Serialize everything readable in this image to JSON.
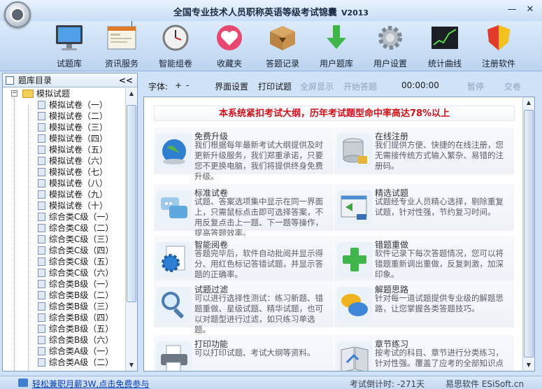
{
  "window": {
    "title": "全国专业技术人员职称英语等级考试锦囊",
    "version": "V2013",
    "minimize": "—",
    "close": "✕"
  },
  "toolbar": {
    "items": [
      {
        "label": "试题库",
        "icon": "monitor-icon"
      },
      {
        "label": "资讯服务",
        "icon": "browser-window-icon"
      },
      {
        "label": "智能组卷",
        "icon": "clock-icon"
      },
      {
        "label": "收藏夹",
        "icon": "heart-icon"
      },
      {
        "label": "答题记录",
        "icon": "box-icon"
      },
      {
        "label": "用户题库",
        "icon": "download-arrow-icon"
      },
      {
        "label": "用户设置",
        "icon": "gear-icon"
      },
      {
        "label": "统计曲线",
        "icon": "chart-icon"
      },
      {
        "label": "注册软件",
        "icon": "shield-icon"
      }
    ]
  },
  "tree": {
    "header": "题库目录",
    "collapse": "<<",
    "root": "模拟试题",
    "items": [
      "模拟试卷（一）",
      "模拟试卷（二）",
      "模拟试卷（三）",
      "模拟试卷（四）",
      "模拟试卷（五）",
      "模拟试卷（六）",
      "模拟试卷（七）",
      "模拟试卷（八）",
      "模拟试卷（九）",
      "模拟试卷（十）",
      "综合类C级（一）",
      "综合类C级（二）",
      "综合类C级（三）",
      "综合类C级（四）",
      "综合类C级（五）",
      "综合类C级（六）",
      "综合类B级（一）",
      "综合类B级（二）",
      "综合类B级（三）",
      "综合类B级（四）",
      "综合类B级（五）",
      "综合类B级（六）",
      "综合类A级（一）",
      "综合类A级（二）"
    ]
  },
  "controls": {
    "font_label": "字体:",
    "font_plus": "+",
    "font_minus": "-",
    "layout": "界面设置",
    "print": "打印试题",
    "fullscreen": "全屏显示",
    "start": "开始答题",
    "time": "00:00:00",
    "pause": "暂停",
    "submit": "交卷"
  },
  "content": {
    "banner": "本系统紧扣考试大纲，历年考试题型命中率高达78%以上",
    "features": [
      {
        "title": "免费升级",
        "desc": "我们根据每年最新考试大纲提供及时更新升级服务，我们郑重承诺，只要您不更换电脑，我们将提供终身免费升级。",
        "icon": "globe-icon"
      },
      {
        "title": "在线注册",
        "desc": "我们提供方便、快捷的在线注册，您无需接传统方式输入繁杂、易错的注册码。",
        "icon": "database-lock-icon"
      },
      {
        "title": "标准试卷",
        "desc": "试题、答案选项集中显示在同一界面上，只需鼠标点击即可选择答案，不用反复点击上一题、下一题等操作，提高答题效率。",
        "icon": "chat-bubbles-icon"
      },
      {
        "title": "精选试题",
        "desc": "试题经专业人员精心选择，剔除重复试题，针对性强，节约复习时间。",
        "icon": "network-window-icon"
      },
      {
        "title": "智能阅卷",
        "desc": "答题完毕后，软件自动批阅并显示得分、用红色标记答错试题，并显示答题的正确率。",
        "icon": "gear-document-icon"
      },
      {
        "title": "错题重做",
        "desc": "软件记录下每次答题情况，您可以将错题重新调出重做，反复刺激，加深印象。",
        "icon": "plus-icon"
      },
      {
        "title": "试题过滤",
        "desc": "可以进行选择性测试：练习新题、错题重做、星级试题、精华试题，也可以对题型进行过滤，如只练习单选题。",
        "icon": "magnifier-icon"
      },
      {
        "title": "解题思路",
        "desc": "针对每一道试题提供专业级的解题思路，让您掌握各类答题技巧。",
        "icon": "speech-bubbles-icon"
      },
      {
        "title": "打印功能",
        "desc": "可以打印试题、考试大纲等资料。",
        "icon": "printer-icon"
      },
      {
        "title": "章节练习",
        "desc": "按考试的科目、章节进行分类练习，针对性强。覆盖了应考的全部知识点",
        "icon": "book-icon"
      }
    ]
  },
  "status": {
    "promo": "轻松兼职月薪3W,点击免费参与",
    "timer": "考试倒计时: -271天",
    "brand": "易思软件 ESiSoft.cn"
  },
  "colors": {
    "accent_red": "#d0111b",
    "link_blue": "#0a3fb5",
    "toolbar_bg": "#c9def6"
  }
}
